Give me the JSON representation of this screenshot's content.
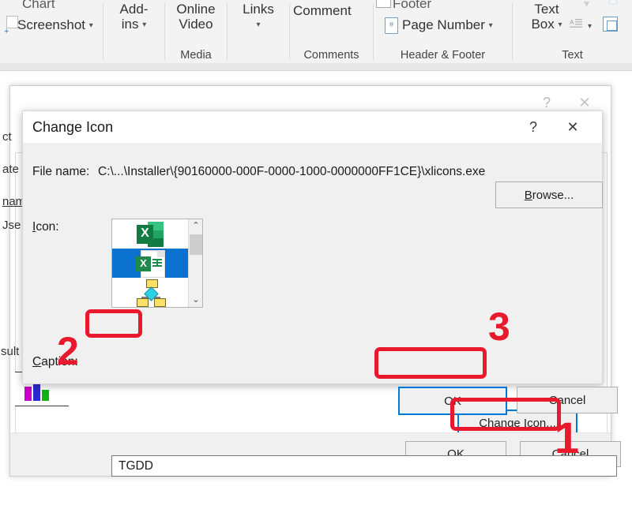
{
  "ribbon": {
    "clipped_items": [
      {
        "label": "Chart"
      },
      {
        "label": "Footer"
      }
    ],
    "groups": [
      {
        "name": "illustrations",
        "label": "",
        "items": [
          {
            "label": "Screenshot",
            "has_caret": true
          }
        ]
      },
      {
        "name": "add-ins",
        "label": "",
        "items": [
          {
            "label": "Add-\nins",
            "has_caret": true
          }
        ]
      },
      {
        "name": "media",
        "label": "Media",
        "items": [
          {
            "label": "Online\nVideo",
            "has_caret": false
          }
        ]
      },
      {
        "name": "links",
        "label": "",
        "items": [
          {
            "label": "Links",
            "has_caret": true
          }
        ]
      },
      {
        "name": "comments",
        "label": "Comments",
        "items": [
          {
            "label": "Comment",
            "has_caret": false
          }
        ]
      },
      {
        "name": "header-footer",
        "label": "Header & Footer",
        "items": [
          {
            "label": "Page Number",
            "has_caret": true
          }
        ]
      },
      {
        "name": "text",
        "label": "Text",
        "items": [
          {
            "label": "Text\nBox",
            "has_caret": true
          }
        ]
      }
    ],
    "group_labels": {
      "media": "Media",
      "comments": "Comments",
      "header_footer": "Header & Footer",
      "text": "Text"
    },
    "item_labels": {
      "screenshot": "Screenshot",
      "addins_1": "Add-",
      "addins_2": "ins",
      "online_1": "Online",
      "online_2": "Video",
      "links": "Links",
      "comment": "Comment",
      "page_number": "Page Number",
      "textbox_1": "Text",
      "textbox_2": "Box",
      "chart_clipped": "Chart",
      "footer_clipped": "Footer"
    }
  },
  "outer_dialog": {
    "title": "",
    "help_icon": "?",
    "close_icon": "✕",
    "background_fragments": {
      "object": "ct",
      "create": "ate",
      "filename": "nam",
      "use": "Jse",
      "result": "sult"
    },
    "buttons": {
      "change_icon": "Change Icon...",
      "change_icon_accel": "I",
      "ok": "OK",
      "cancel": "Cancel"
    }
  },
  "change_icon_dialog": {
    "title": "Change Icon",
    "help_icon": "?",
    "close_icon": "✕",
    "file_name_label": "File name:",
    "file_name_value": "C:\\...\\Installer\\{90160000-000F-0000-1000-0000000FF1CE}\\xlicons.exe",
    "browse_label": "Browse...",
    "browse_accel": "B",
    "icon_label": "Icon:",
    "icon_label_accel": "I",
    "icons": [
      {
        "name": "excel-app-icon",
        "selected": false
      },
      {
        "name": "excel-document-icon",
        "selected": true
      },
      {
        "name": "flowchart-icon",
        "selected": false
      }
    ],
    "scrollbar": {
      "up": "⌃",
      "down": "⌄"
    },
    "caption_label": "Caption:",
    "caption_accel": "C",
    "caption_value": "TGDD",
    "caption_placeholder": "",
    "ok_label": "OK",
    "cancel_label": "Cancel"
  },
  "annotations": {
    "color": "#e8192c",
    "markers": [
      {
        "number": "1",
        "target": "change-icon-button"
      },
      {
        "number": "2",
        "target": "caption-input"
      },
      {
        "number": "3",
        "target": "ok-button"
      }
    ]
  }
}
